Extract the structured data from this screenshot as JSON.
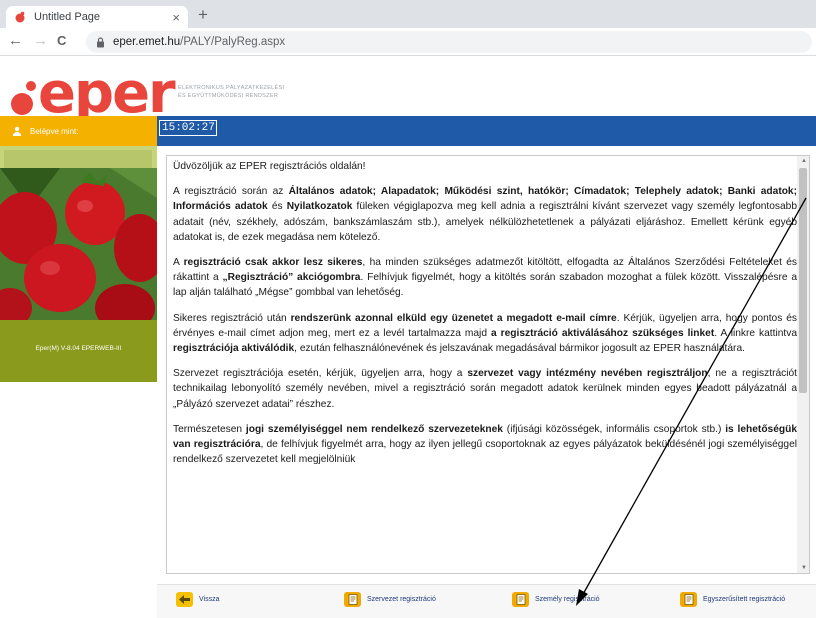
{
  "browser": {
    "tab_title": "Untitled Page",
    "tab_close": "×",
    "new_tab": "+",
    "back": "←",
    "forward": "→",
    "reload": "C",
    "url_host": "eper.emet.hu",
    "url_path": "/PALY/PalyReg.aspx"
  },
  "header": {
    "logo_text": "eper",
    "logo_sub_line1": "ELEKTRONIKUS PÁLYÁZATKEZELÉSI",
    "logo_sub_line2": "ÉS EGYÜTTMŰKÖDÉSI RENDSZER"
  },
  "topbar": {
    "login_label": "Belépve mint:",
    "clock": "15:02:27"
  },
  "sidebar": {
    "version": "Eper(M) V-8.04 EPERWEB-III"
  },
  "content": {
    "greeting": "Üdvözöljük az EPER regisztrációs oldalán!",
    "p1_a": "A regisztráció során az ",
    "p1_b1": "Általános adatok; Alapadatok; Működési szint, hatókör; Címadatok; Telephely adatok; Banki adatok; Információs adatok",
    "p1_c": " és ",
    "p1_b2": "Nyilatkozatok",
    "p1_d": " füleken végiglapozva meg kell adnia a regisztrálni kívánt szervezet vagy személy legfontosabb adatait (név, székhely, adószám, bankszámlaszám stb.), amelyek nélkülözhetetlenek a pályázati eljáráshoz. Emellett kérünk egyéb adatokat is, de ezek megadása nem kötelező.",
    "p2_a": "A ",
    "p2_b1": "regisztráció csak akkor lesz sikeres",
    "p2_c": ", ha minden szükséges adatmezőt kitöltött, elfogadta az Általános Szerződési Feltételeket és rákattint a ",
    "p2_b2": "„Regisztráció” akciógombra",
    "p2_d": ". Felhívjuk figyelmét, hogy a kitöltés során szabadon mozoghat a fülek között. Visszalépésre a lap alján található „Mégse” gombbal van lehetőség.",
    "p3_a": "Sikeres regisztráció után ",
    "p3_b1": "rendszerünk azonnal elküld egy üzenetet a megadott e-mail címre",
    "p3_c": ". Kérjük, ügyeljen arra, hogy pontos és érvényes e-mail címet adjon meg, mert ez a levél tartalmazza majd ",
    "p3_b2": "a regisztráció aktiválásához szükséges linket",
    "p3_d": ". A linkre kattintva ",
    "p3_b3": "regisztrációja aktiválódik",
    "p3_e": ", ezután felhasználónevének és jelszavának megadásával bármikor jogosult az EPER használatára.",
    "p4_a": "Szervezet regisztrációja esetén, kérjük, ügyeljen arra, hogy a ",
    "p4_b1": "szervezet vagy intézmény nevében regisztráljon",
    "p4_c": ", ne a regisztrációt technikailag lebonyolító személy nevében, mivel a regisztráció során megadott adatok kerülnek minden egyes beadott pályázatnál a „Pályázó szervezet adatai” részhez.",
    "p5_a": "Természetesen ",
    "p5_b1": "jogi személyiséggel nem rendelkező szervezeteknek",
    "p5_c": " (ifjúsági közösségek, informális csoportok stb.) ",
    "p5_b2": "is lehetőségük van regisztrációra",
    "p5_d": ", de felhívjuk figyelmét arra, hogy az ilyen jellegű csoportoknak az egyes pályázatok beküldésénél jogi személyiséggel rendelkező szervezetet kell megjelölniük"
  },
  "buttons": {
    "back": "Vissza",
    "org_reg": "Szervezet regisztráció",
    "person_reg": "Személy regisztráció",
    "simple_reg": "Egyszerűsített regisztráció"
  },
  "colors": {
    "brand_red": "#e8463d",
    "header_blue": "#1e5aa8",
    "login_yellow": "#f5b100",
    "sidebar_olive": "#8a9a1c"
  }
}
